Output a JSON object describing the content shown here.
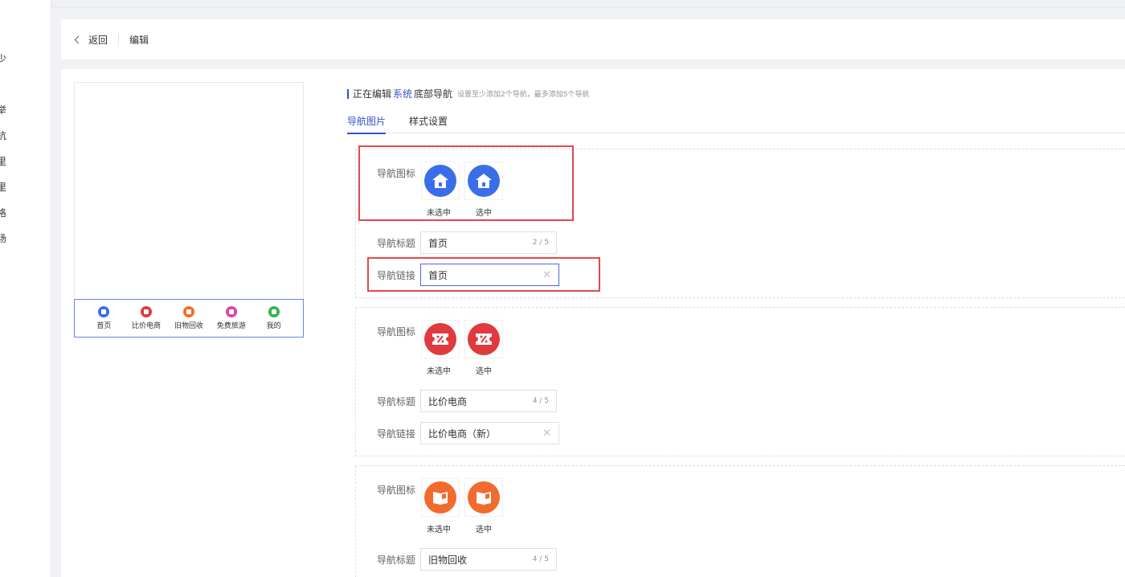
{
  "sidebar": {
    "fragments": [
      "少",
      "举",
      "杭",
      "里",
      "里",
      "格",
      "场"
    ]
  },
  "header": {
    "back_label": "返回",
    "title": "编辑"
  },
  "preview": {
    "nav_items": [
      {
        "label": "首页",
        "color": "#3a6ee8"
      },
      {
        "label": "比价电商",
        "color": "#e0393e"
      },
      {
        "label": "旧物回收",
        "color": "#f26b2e"
      },
      {
        "label": "免费旅游",
        "color": "#d946a8"
      },
      {
        "label": "我的",
        "color": "#34b34a"
      }
    ]
  },
  "editor": {
    "title_prefix": "正在编辑",
    "title_accent": "系统",
    "title_suffix": "底部导航",
    "hint": "设置至少添加2个导航，最多添加5个导航",
    "tabs": [
      {
        "label": "导航图片",
        "active": true
      },
      {
        "label": "样式设置",
        "active": false
      }
    ]
  },
  "labels": {
    "icon": "导航图标",
    "title": "导航标题",
    "link": "导航链接",
    "unselected": "未选中",
    "selected": "选中"
  },
  "cards": [
    {
      "icon_name": "home-icon",
      "color": "#3a6ee8",
      "title": "首页",
      "count": "2 / 5",
      "link": "首页"
    },
    {
      "icon_name": "coupon-icon",
      "color": "#e0393e",
      "title": "比价电商",
      "count": "4 / 5",
      "link": "比价电商（新）"
    },
    {
      "icon_name": "box-icon",
      "color": "#f26b2e",
      "title": "旧物回收",
      "count": "4 / 5",
      "link": ""
    }
  ],
  "colors": {
    "accent": "#3451c7",
    "highlight": "#e5474b"
  }
}
